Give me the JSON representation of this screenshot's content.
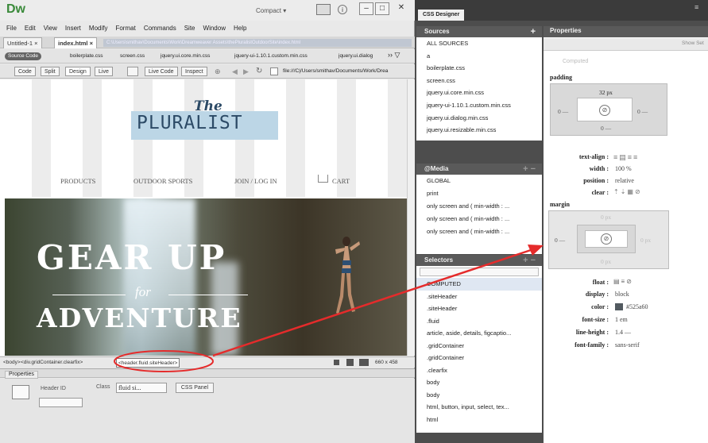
{
  "app": {
    "logo": "Dw",
    "layout_mode": "Compact ▾",
    "window_buttons": [
      "–",
      "□",
      "✕"
    ]
  },
  "menu": [
    "File",
    "Edit",
    "View",
    "Insert",
    "Modify",
    "Format",
    "Commands",
    "Site",
    "Window",
    "Help"
  ],
  "doc_tabs": [
    {
      "label": "Untitled-1 ×"
    },
    {
      "label": "index.html ×"
    }
  ],
  "doc_path": "C:\\Users\\smithav\\Documents\\Work\\Dreamweaver Assets\\thePluralistOutdoorSite\\index.html",
  "related_files": {
    "source_code": "Source Code",
    "files": [
      "boilerplate.css",
      "screen.css",
      "jquery.ui.core.min.css",
      "jquery-ui-1.10.1.custom.min.css",
      "jquery.ui.dialog"
    ]
  },
  "toolbar": {
    "buttons": [
      "Code",
      "Split",
      "Design",
      "Live"
    ],
    "live_code": "Live Code",
    "inspect": "Inspect",
    "address": "file:///C|/Users/smithav/Documents/Work/Drea"
  },
  "page": {
    "brand_the": "The",
    "brand_name": "PLURALIST",
    "nav": [
      "PRODUCTS",
      "OUTDOOR SPORTS",
      "JOIN / LOG IN",
      "CART"
    ],
    "hero_line1": "GEAR UP",
    "hero_line2": "for",
    "hero_line3": "ADVENTURE"
  },
  "tag_selector": {
    "body": "<body>",
    "div": "<div.gridContainer.clearfix>",
    "active": "<header.fluid.siteHeader>",
    "status": "660 x 458"
  },
  "properties_inspector": {
    "title": "Properties",
    "header_id_label": "Header ID",
    "class_label": "Class",
    "class_value": "fluid si...",
    "css_panel": "CSS Panel"
  },
  "css_designer": {
    "tab": "CSS Designer",
    "sources_title": "Sources",
    "sources": [
      "ALL SOURCES",
      "a",
      "boilerplate.css",
      "screen.css",
      "jquery.ui.core.min.css",
      "jquery-ui-1.10.1.custom.min.css",
      "jquery.ui.dialog.min.css",
      "jquery.ui.resizable.min.css"
    ],
    "media_title": "@Media",
    "media": [
      "GLOBAL",
      "print",
      "only screen and ( min-width : ...",
      "only screen and ( min-width : ...",
      "only screen and ( min-width : ..."
    ],
    "selectors_title": "Selectors",
    "selectors": [
      "COMPUTED",
      ".siteHeader",
      ".siteHeader",
      ".fluid",
      "article, aside, details, figcaptio...",
      ".gridContainer",
      ".gridContainer",
      ".clearfix",
      "body",
      "body",
      "html, button, input, select, tex...",
      "html"
    ],
    "selected_index": 0
  },
  "properties": {
    "title": "Properties",
    "show_set": "Show Set",
    "computed": "Computed",
    "padding_label": "padding",
    "padding_top": "32 px",
    "padding_left": "0 —",
    "padding_right": "0 —",
    "padding_bottom": "0 —",
    "text_align_label": "text-align :",
    "width_label": "width :",
    "width_value": "100 %",
    "position_label": "position :",
    "position_value": "relative",
    "clear_label": "clear :",
    "margin_label": "margin",
    "margin_top": "0 px",
    "margin_left": "0 —",
    "margin_right": "0 px",
    "margin_bottom": "0 px",
    "float_label": "float :",
    "display_label": "display :",
    "display_value": "block",
    "color_label": "color :",
    "color_value": "#525a60",
    "font_size_label": "font-size :",
    "font_size_value": "1 em",
    "line_height_label": "line-height :",
    "line_height_value": "1.4 —",
    "font_family_label": "font-family :",
    "font_family_value": "sans-serif"
  },
  "colors": {
    "accent_red": "#e52b2b",
    "brand_blue": "#2c4a66",
    "brand_box": "#bcd6e6",
    "color_swatch": "#525a60"
  }
}
